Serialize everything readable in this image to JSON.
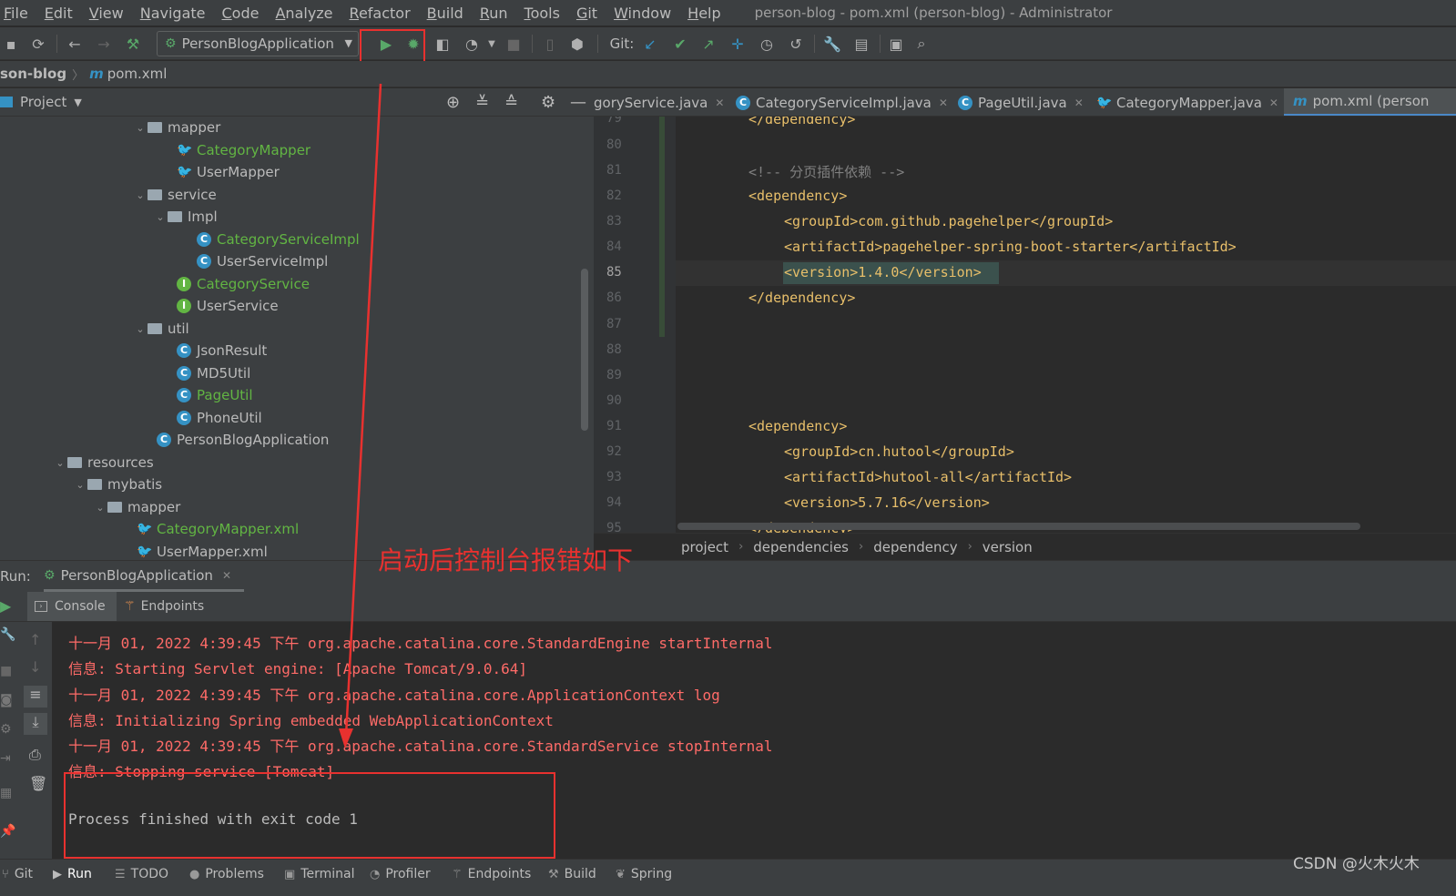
{
  "menu": {
    "items": [
      "File",
      "Edit",
      "View",
      "Navigate",
      "Code",
      "Analyze",
      "Refactor",
      "Build",
      "Run",
      "Tools",
      "Git",
      "Window",
      "Help"
    ],
    "window_title": "person-blog - pom.xml (person-blog) - Administrator"
  },
  "toolbar": {
    "run_config": "PersonBlogApplication",
    "git_label": "Git:"
  },
  "navbar": {
    "project": "son-blog",
    "file": "pom.xml"
  },
  "project_panel": {
    "title": "Project",
    "tree": [
      {
        "label": "mapper",
        "type": "folder",
        "expanded": true
      },
      {
        "label": "CategoryMapper",
        "type": "mapper-changed"
      },
      {
        "label": "UserMapper",
        "type": "mapper"
      },
      {
        "label": "service",
        "type": "folder",
        "expanded": true
      },
      {
        "label": "Impl",
        "type": "folder",
        "expanded": true
      },
      {
        "label": "CategoryServiceImpl",
        "type": "class-changed"
      },
      {
        "label": "UserServiceImpl",
        "type": "class"
      },
      {
        "label": "CategoryService",
        "type": "interface-changed"
      },
      {
        "label": "UserService",
        "type": "interface"
      },
      {
        "label": "util",
        "type": "folder",
        "expanded": true
      },
      {
        "label": "JsonResult",
        "type": "class"
      },
      {
        "label": "MD5Util",
        "type": "class"
      },
      {
        "label": "PageUtil",
        "type": "class-changed"
      },
      {
        "label": "PhoneUtil",
        "type": "class"
      },
      {
        "label": "PersonBlogApplication",
        "type": "spring"
      },
      {
        "label": "resources",
        "type": "folder",
        "expanded": true
      },
      {
        "label": "mybatis",
        "type": "folder",
        "expanded": true
      },
      {
        "label": "mapper",
        "type": "folder",
        "expanded": true
      },
      {
        "label": "CategoryMapper.xml",
        "type": "xml-changed"
      },
      {
        "label": "UserMapper.xml",
        "type": "xml"
      }
    ]
  },
  "editor_tabs": [
    {
      "label": "goryService.java"
    },
    {
      "label": "CategoryServiceImpl.java"
    },
    {
      "label": "PageUtil.java"
    },
    {
      "label": "CategoryMapper.java"
    },
    {
      "label": "pom.xml (person"
    }
  ],
  "editor": {
    "lines": [
      {
        "n": "79",
        "text": "</dependency>"
      },
      {
        "n": "80",
        "text": ""
      },
      {
        "n": "81",
        "text": "<!-- 分页插件依赖 -->"
      },
      {
        "n": "82",
        "text": "<dependency>"
      },
      {
        "n": "83",
        "text": "<groupId>com.github.pagehelper</groupId>"
      },
      {
        "n": "84",
        "text": "<artifactId>pagehelper-spring-boot-starter</artifactId>"
      },
      {
        "n": "85",
        "text": "<version>1.4.0</version>"
      },
      {
        "n": "86",
        "text": "</dependency>"
      },
      {
        "n": "87",
        "text": ""
      },
      {
        "n": "88",
        "text": ""
      },
      {
        "n": "89",
        "text": ""
      },
      {
        "n": "90",
        "text": ""
      },
      {
        "n": "91",
        "text": "<dependency>"
      },
      {
        "n": "92",
        "text": "<groupId>cn.hutool</groupId>"
      },
      {
        "n": "93",
        "text": "<artifactId>hutool-all</artifactId>"
      },
      {
        "n": "94",
        "text": "<version>5.7.16</version>"
      },
      {
        "n": "95",
        "text": "</dependency>"
      }
    ],
    "breadcrumbs": [
      "project",
      "dependencies",
      "dependency",
      "version"
    ]
  },
  "run_panel": {
    "label": "Run:",
    "config": "PersonBlogApplication",
    "tabs": [
      "Console",
      "Endpoints"
    ],
    "console_lines": [
      "十一月 01, 2022 4:39:45 下午 org.apache.catalina.core.StandardEngine startInternal",
      "信息: Starting Servlet engine: [Apache Tomcat/9.0.64]",
      "十一月 01, 2022 4:39:45 下午 org.apache.catalina.core.ApplicationContext log",
      "信息: Initializing Spring embedded WebApplicationContext",
      "十一月 01, 2022 4:39:45 下午 org.apache.catalina.core.StandardService stopInternal",
      "信息: Stopping service [Tomcat]",
      "",
      "Process finished with exit code 1"
    ]
  },
  "statusbar": {
    "items": [
      "Git",
      "Run",
      "TODO",
      "Problems",
      "Terminal",
      "Profiler",
      "Endpoints",
      "Build",
      "Spring"
    ]
  },
  "annotation": "启动后控制台报错如下",
  "watermark": "CSDN @火木火木",
  "colors": {
    "annotation_red": "#e8312f",
    "error_text": "#ff6b68",
    "xml_tag": "#e8bf6a",
    "run_green": "#59a869"
  }
}
